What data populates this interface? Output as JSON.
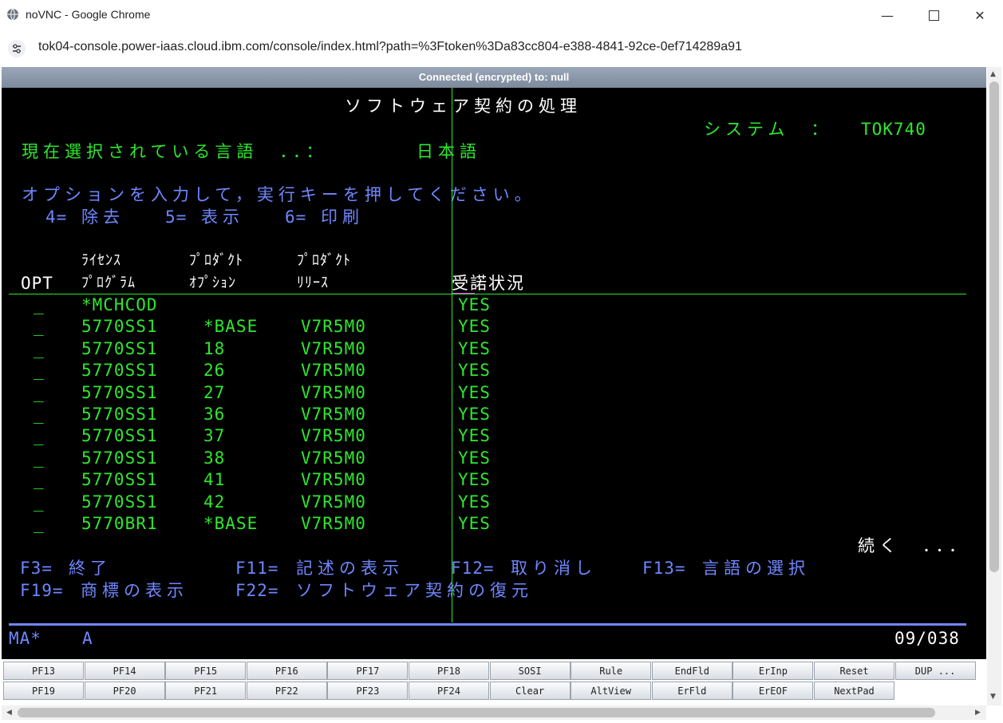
{
  "window": {
    "title": "noVNC - Google Chrome",
    "url": "tok04-console.power-iaas.cloud.ibm.com/console/index.html?path=%3Ftoken%3Da83cc804-e388-4841-92ce-0ef714289a91",
    "minimize_icon": "minimize-icon",
    "maximize_icon": "maximize-icon",
    "close_icon": "close-icon"
  },
  "vnc": {
    "status": "Connected (encrypted) to: null"
  },
  "terminal": {
    "title": "ソフトウェア契約の処理",
    "system_label": "システム　：",
    "system_value": "TOK740",
    "language_label": "現在選択されている言語　．．：",
    "language_value": "日本語",
    "instruction": "オプションを入力して，実行キーを押してください。",
    "options": [
      {
        "key": "4=",
        "label": "除去"
      },
      {
        "key": "5=",
        "label": "表示"
      },
      {
        "key": "6=",
        "label": "印刷"
      }
    ],
    "headers": {
      "opt": "OPT",
      "license_1": "ﾗｲｾﾝｽ",
      "license_2": "ﾌﾟﾛｸﾞﾗﾑ",
      "product_opt_1": "ﾌﾟﾛﾀﾞｸﾄ",
      "product_opt_2": "ｵﾌﾟｼｮﾝ",
      "product_rel_1": "ﾌﾟﾛﾀﾞｸﾄ",
      "product_rel_2": "ﾘﾘｰｽ",
      "accept": "受諾状況"
    },
    "rows": [
      {
        "opt": "_",
        "program": "*MCHCOD",
        "option": "",
        "release": "",
        "status": "YES"
      },
      {
        "opt": "_",
        "program": "5770SS1",
        "option": "*BASE",
        "release": "V7R5M0",
        "status": "YES"
      },
      {
        "opt": "_",
        "program": "5770SS1",
        "option": "18",
        "release": "V7R5M0",
        "status": "YES"
      },
      {
        "opt": "_",
        "program": "5770SS1",
        "option": "26",
        "release": "V7R5M0",
        "status": "YES"
      },
      {
        "opt": "_",
        "program": "5770SS1",
        "option": "27",
        "release": "V7R5M0",
        "status": "YES"
      },
      {
        "opt": "_",
        "program": "5770SS1",
        "option": "36",
        "release": "V7R5M0",
        "status": "YES"
      },
      {
        "opt": "_",
        "program": "5770SS1",
        "option": "37",
        "release": "V7R5M0",
        "status": "YES"
      },
      {
        "opt": "_",
        "program": "5770SS1",
        "option": "38",
        "release": "V7R5M0",
        "status": "YES"
      },
      {
        "opt": "_",
        "program": "5770SS1",
        "option": "41",
        "release": "V7R5M0",
        "status": "YES"
      },
      {
        "opt": "_",
        "program": "5770SS1",
        "option": "42",
        "release": "V7R5M0",
        "status": "YES"
      },
      {
        "opt": "_",
        "program": "5770BR1",
        "option": "*BASE",
        "release": "V7R5M0",
        "status": "YES"
      }
    ],
    "more": "続く　．．．",
    "fkeys_row1": [
      {
        "key": "F3=",
        "label": "終了"
      },
      {
        "key": "F11=",
        "label": "記述の表示"
      },
      {
        "key": "F12=",
        "label": "取り消し"
      },
      {
        "key": "F13=",
        "label": "言語の選択"
      }
    ],
    "fkeys_row2": [
      {
        "key": "F19=",
        "label": "商標の表示"
      },
      {
        "key": "F22=",
        "label": "ソフトウェア契約の復元"
      }
    ],
    "status_left": "MA*",
    "status_mid": "A",
    "status_right": "09/038"
  },
  "keypad": {
    "row1": [
      "PF13",
      "PF14",
      "PF15",
      "PF16",
      "PF17",
      "PF18",
      "SOSI",
      "Rule",
      "EndFld",
      "ErInp",
      "Reset",
      "DUP ..."
    ],
    "row2": [
      "PF19",
      "PF20",
      "PF21",
      "PF22",
      "PF23",
      "PF24",
      "Clear",
      "AltView",
      "ErFld",
      "ErEOF",
      "NextPad"
    ]
  }
}
